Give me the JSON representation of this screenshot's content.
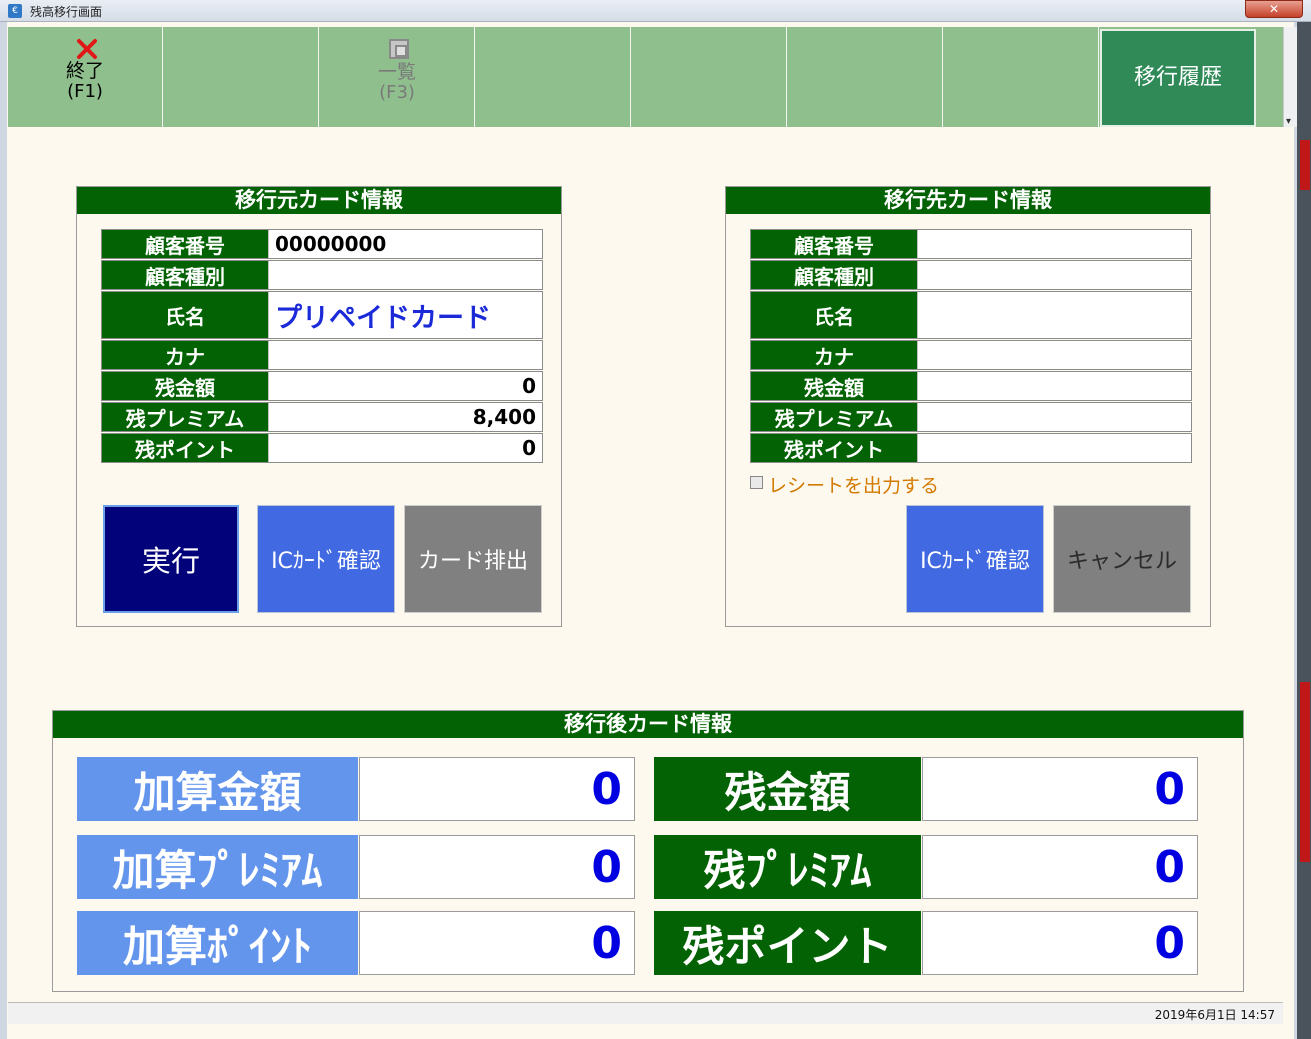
{
  "window": {
    "title": "残高移行画面"
  },
  "toolbar": {
    "exit_label": "終了",
    "exit_key": "(F1)",
    "list_label": "一覧",
    "list_key": "(F3)",
    "history_label": "移行履歴"
  },
  "source": {
    "header": "移行元カード情報",
    "labels": {
      "customer_no": "顧客番号",
      "customer_type": "顧客種別",
      "name": "氏名",
      "kana": "カナ",
      "balance": "残金額",
      "premium": "残プレミアム",
      "points": "残ポイント"
    },
    "values": {
      "customer_no": "00000000",
      "customer_type": "",
      "name": "プリペイドカード",
      "kana": "",
      "balance": "0",
      "premium": "8,400",
      "points": "0"
    },
    "buttons": {
      "execute": "実行",
      "ic_check": "ICｶｰﾄﾞ確認",
      "eject": "カード排出"
    }
  },
  "dest": {
    "header": "移行先カード情報",
    "labels": {
      "customer_no": "顧客番号",
      "customer_type": "顧客種別",
      "name": "氏名",
      "kana": "カナ",
      "balance": "残金額",
      "premium": "残プレミアム",
      "points": "残ポイント"
    },
    "values": {
      "customer_no": "",
      "customer_type": "",
      "name": "",
      "kana": "",
      "balance": "",
      "premium": "",
      "points": ""
    },
    "receipt_label": "レシートを出力する",
    "receipt_checked": false,
    "buttons": {
      "ic_check": "ICｶｰﾄﾞ確認",
      "cancel": "キャンセル"
    }
  },
  "after": {
    "header": "移行後カード情報",
    "add_amount_label": "加算金額",
    "add_amount_value": "0",
    "add_premium_label": "加算ﾌﾟﾚﾐｱﾑ",
    "add_premium_value": "0",
    "add_points_label": "加算ﾎﾟｲﾝﾄ",
    "add_points_value": "0",
    "balance_label": "残金額",
    "balance_value": "0",
    "premium_label": "残ﾌﾟﾚﾐｱﾑ",
    "premium_value": "0",
    "points_label": "残ポイント",
    "points_value": "0"
  },
  "status": {
    "datetime": "2019年6月1日 14:57"
  },
  "colors": {
    "toolbar": "#8fbf8d",
    "header_green": "#036203",
    "light_blue": "#6495ed",
    "navy": "#02027a",
    "royal_blue": "#4169e1",
    "value_blue": "#0000e0",
    "receipt_orange": "#d47a00"
  }
}
